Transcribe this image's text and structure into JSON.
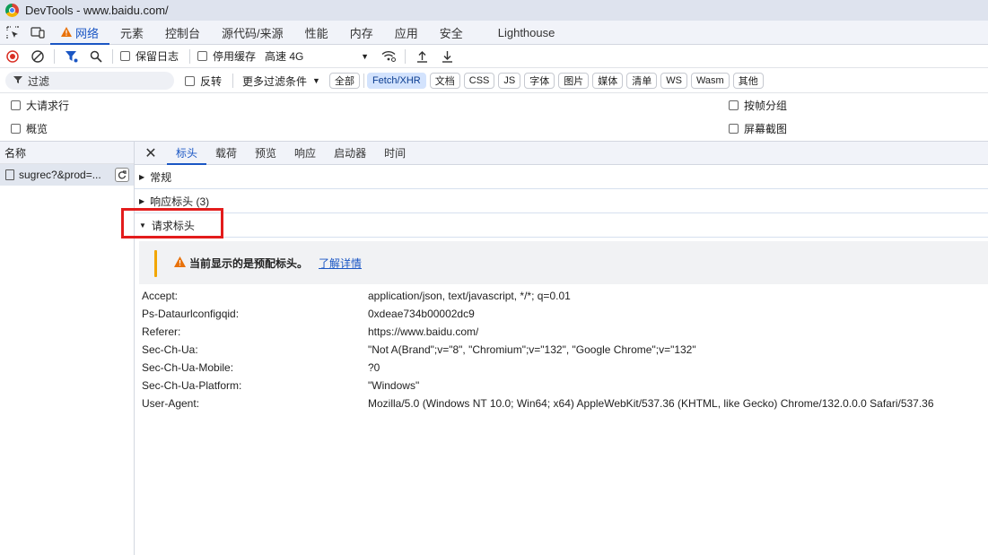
{
  "window": {
    "title": "DevTools - www.baidu.com/"
  },
  "tabs": [
    "网络",
    "元素",
    "控制台",
    "源代码/来源",
    "性能",
    "内存",
    "应用",
    "安全",
    "Lighthouse"
  ],
  "toolbar": {
    "preserve_log": "保留日志",
    "disable_cache": "停用缓存",
    "throttle": "高速 4G"
  },
  "filter": {
    "placeholder": "过滤",
    "invert": "反转",
    "more_filters": "更多过滤条件",
    "chips": [
      "全部",
      "Fetch/XHR",
      "文档",
      "CSS",
      "JS",
      "字体",
      "图片",
      "媒体",
      "清单",
      "WS",
      "Wasm",
      "其他"
    ]
  },
  "options": {
    "big_rows": "大请求行",
    "overview": "概览",
    "group_by_frame": "按帧分组",
    "screenshots": "屏幕截图"
  },
  "request_list": {
    "header": "名称",
    "items": [
      {
        "name": "sugrec?&prod=..."
      }
    ]
  },
  "detail_tabs": [
    "标头",
    "载荷",
    "预览",
    "响应",
    "启动器",
    "时间"
  ],
  "sections": {
    "general": "常规",
    "response_headers": "响应标头 (3)",
    "request_headers": "请求标头"
  },
  "warning": {
    "text": "当前显示的是预配标头。",
    "link": "了解详情"
  },
  "request_headers": [
    {
      "key": "Accept:",
      "value": "application/json, text/javascript, */*; q=0.01"
    },
    {
      "key": "Ps-Dataurlconfigqid:",
      "value": "0xdeae734b00002dc9"
    },
    {
      "key": "Referer:",
      "value": "https://www.baidu.com/"
    },
    {
      "key": "Sec-Ch-Ua:",
      "value": "\"Not A(Brand\";v=\"8\", \"Chromium\";v=\"132\", \"Google Chrome\";v=\"132\""
    },
    {
      "key": "Sec-Ch-Ua-Mobile:",
      "value": "?0"
    },
    {
      "key": "Sec-Ch-Ua-Platform:",
      "value": "\"Windows\""
    },
    {
      "key": "User-Agent:",
      "value": "Mozilla/5.0 (Windows NT 10.0; Win64; x64) AppleWebKit/537.36 (KHTML, like Gecko) Chrome/132.0.0.0 Safari/537.36"
    }
  ],
  "colors": {
    "accent": "#1a56c4",
    "record": "#d93025",
    "warning": "#f2a600",
    "highlight": "#e31c1c"
  }
}
